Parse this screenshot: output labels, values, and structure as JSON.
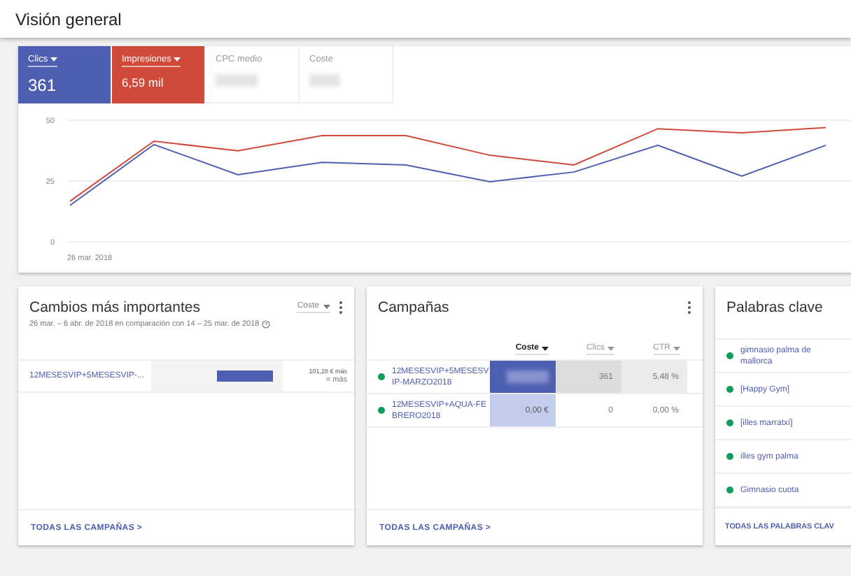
{
  "header": {
    "title": "Visión general"
  },
  "metrics": [
    {
      "label": "Clics",
      "value": "361",
      "selected": true,
      "color": "#4e5fb1"
    },
    {
      "label": "Impresiones",
      "value": "6,59 mil",
      "selected": true,
      "color": "#cf4a3a"
    },
    {
      "label": "CPC medio",
      "selected": false
    },
    {
      "label": "Coste",
      "selected": false
    }
  ],
  "chart_start_date": "26 mar. 2018",
  "chart_data": {
    "type": "line",
    "ylim": [
      0,
      50
    ],
    "yticks": [
      {
        "value": 0,
        "label": "0"
      },
      {
        "value": 25,
        "label": "25"
      },
      {
        "value": 50,
        "label": "50"
      }
    ],
    "series": [
      {
        "color": "#4e5fb1",
        "values": [
          15,
          40,
          27.6,
          32.7,
          31.6,
          24.7,
          28.7,
          39.7,
          27,
          39.7
        ]
      },
      {
        "color": "#cf4a3a",
        "values": [
          16.7,
          41.4,
          37.4,
          43.7,
          43.7,
          35.6,
          31.6,
          46.5,
          44.8,
          47
        ]
      }
    ]
  },
  "changes": {
    "title": "Cambios más importantes",
    "sort": "Coste",
    "subtitle": "26 mar. – 6 abr. de 2018 en comparación con 14 – 25 mar. de 2018",
    "rows": [
      {
        "name": "12MESESVIP+5MESESVIP-...",
        "level": 0.85,
        "change": "101,28 € más",
        "detail": "= más"
      }
    ],
    "link": "TODAS LAS CAMPAÑAS >"
  },
  "campaigns": {
    "title": "Campañas",
    "columns": [
      {
        "label": "Coste",
        "selected": true
      },
      {
        "label": "Clics",
        "selected": false
      },
      {
        "label": "CTR",
        "selected": false
      }
    ],
    "rows": [
      {
        "name": "12MESESVIP+5MESESVIP-MARZO2018",
        "color": "#0f9d58",
        "strong": true,
        "clicks": "361",
        "clicks_shaded": true,
        "ctr": "5,48 %"
      },
      {
        "name": "12MESESVIP+AQUA-FEBRERO2018",
        "color": "#0f9d58",
        "strong": false,
        "cost": "0,00 €",
        "clicks": "0",
        "clicks_shaded": false,
        "ctr": "0,00 %"
      }
    ],
    "link": "TODAS LAS CAMPAÑAS >"
  },
  "keywords": {
    "title": "Palabras clave",
    "items": [
      {
        "text": "gimnasio palma de mallorca",
        "color": "#0f9d58"
      },
      {
        "text": "[Happy Gym]",
        "color": "#0f9d58"
      },
      {
        "text": "[illes marratxí]",
        "color": "#0f9d58"
      },
      {
        "text": "illes gym palma",
        "color": "#0f9d58"
      },
      {
        "text": "Gimnasio cuota",
        "color": "#0f9d58"
      }
    ],
    "link": "TODAS LAS PALABRAS CLAV"
  }
}
